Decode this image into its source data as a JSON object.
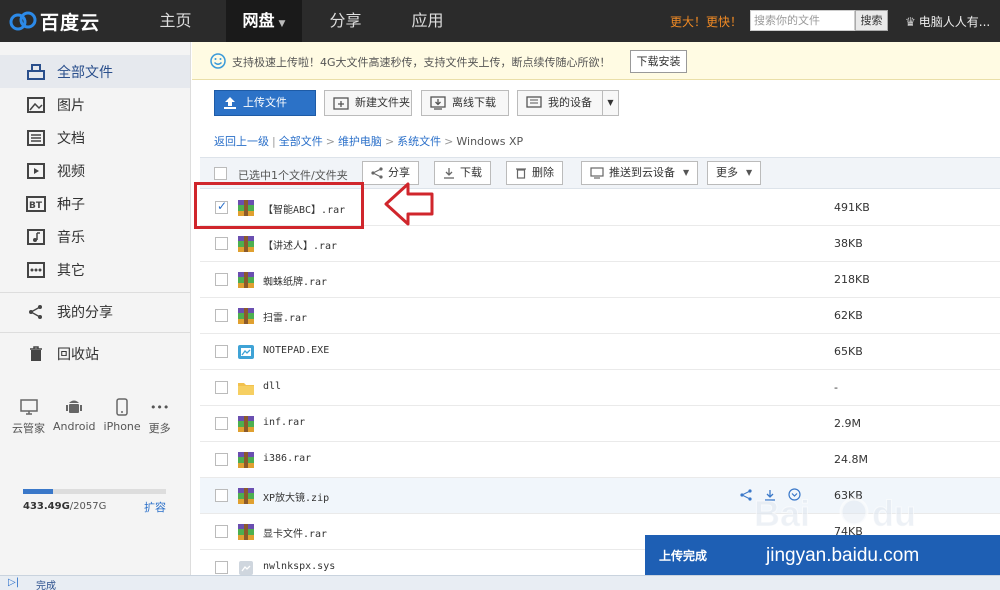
{
  "topbar": {
    "logo_text": "百度云",
    "nav": [
      {
        "label": "主页"
      },
      {
        "label": "网盘"
      },
      {
        "label": "分享"
      },
      {
        "label": "应用"
      }
    ],
    "promo": "更大！更快！",
    "search_placeholder": "搜索你的文件",
    "search_button": "搜索",
    "user": "电脑人人有..."
  },
  "sidebar": {
    "items": [
      {
        "label": "全部文件",
        "icon": "all-files-icon"
      },
      {
        "label": "图片",
        "icon": "image-icon"
      },
      {
        "label": "文档",
        "icon": "document-icon"
      },
      {
        "label": "视频",
        "icon": "video-icon"
      },
      {
        "label": "种子",
        "icon": "bt-icon"
      },
      {
        "label": "音乐",
        "icon": "music-icon"
      },
      {
        "label": "其它",
        "icon": "other-icon"
      },
      {
        "label": "我的分享",
        "icon": "share-icon"
      },
      {
        "label": "回收站",
        "icon": "trash-icon"
      }
    ],
    "devices": [
      {
        "label": "云管家",
        "icon": "monitor-icon"
      },
      {
        "label": "Android",
        "icon": "android-icon"
      },
      {
        "label": "iPhone",
        "icon": "phone-icon"
      },
      {
        "label": "更多",
        "icon": "more-icon"
      }
    ],
    "quota": {
      "used": "433.49G",
      "total": "2057G",
      "fraction": 0.21
    },
    "expand": "扩容"
  },
  "notice": {
    "text": "支持极速上传啦！4G大文件高速秒传，支持文件夹上传，断点续传随心所欲！",
    "button": "下载安装"
  },
  "toolbar": {
    "upload": "上传文件",
    "new_folder": "新建文件夹",
    "offline": "离线下载",
    "devices": "我的设备"
  },
  "breadcrumb": {
    "back": "返回上一级",
    "items": [
      "全部文件",
      "维护电脑",
      "系统文件"
    ],
    "current": "Windows XP"
  },
  "actionbar": {
    "selected": "已选中1个文件/文件夹",
    "share": "分享",
    "download": "下载",
    "delete": "删除",
    "push": "推送到云设备",
    "more": "更多"
  },
  "files": [
    {
      "name": "【智能ABC】.rar",
      "size": "491KB",
      "type": "rar",
      "checked": true
    },
    {
      "name": "【讲述人】.rar",
      "size": "38KB",
      "type": "rar"
    },
    {
      "name": "蜘蛛纸牌.rar",
      "size": "218KB",
      "type": "rar"
    },
    {
      "name": "扫雷.rar",
      "size": "62KB",
      "type": "rar"
    },
    {
      "name": "NOTEPAD.EXE",
      "size": "65KB",
      "type": "exe"
    },
    {
      "name": "dll",
      "size": "-",
      "type": "folder"
    },
    {
      "name": "inf.rar",
      "size": "2.9M",
      "type": "rar"
    },
    {
      "name": "i386.rar",
      "size": "24.8M",
      "type": "rar"
    },
    {
      "name": "XP放大镜.zip",
      "size": "63KB",
      "type": "rar",
      "hover": true
    },
    {
      "name": "显卡文件.rar",
      "size": "74KB",
      "type": "rar"
    },
    {
      "name": "nwlnkspx.sys",
      "size": "",
      "type": "sys"
    }
  ],
  "toast": {
    "text": "上传完成"
  },
  "statusbar": {
    "text": "完成"
  },
  "watermark": {
    "url": "jingyan.baidu.com"
  },
  "colors": {
    "accent": "#2c72c7",
    "highlight": "#d0262c",
    "promo": "#f08a24"
  }
}
